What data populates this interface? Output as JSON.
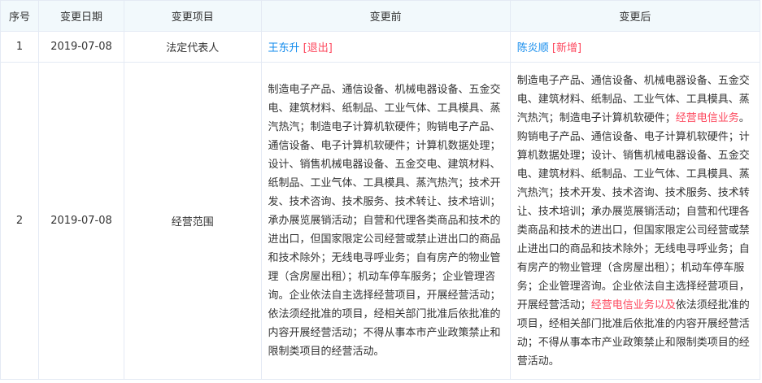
{
  "table": {
    "headers": [
      "序号",
      "变更日期",
      "变更项目",
      "变更前",
      "变更后"
    ],
    "rows": [
      {
        "seq": "1",
        "date": "2019-07-08",
        "item": "法定代表人",
        "before": {
          "name": "王东升",
          "tag": "[退出]"
        },
        "after": {
          "name": "陈炎顺",
          "tag": "[新增]"
        }
      },
      {
        "seq": "2",
        "date": "2019-07-08",
        "item": "经营范围",
        "before_text": "制造电子产品、通信设备、机械电器设备、五金交电、建筑材料、纸制品、工业气体、工具模具、蒸汽热汽；制造电子计算机软硬件；购销电子产品、通信设备、电子计算机软硬件；计算机数据处理；设计、销售机械电器设备、五金交电、建筑材料、纸制品、工业气体、工具模具、蒸汽热汽；技术开发、技术咨询、技术服务、技术转让、技术培训；承办展览展销活动；自营和代理各类商品和技术的进出口，但国家限定公司经营或禁止进出口的商品和技术除外；无线电寻呼业务；自有房产的物业管理（含房屋出租）；机动车停车服务；企业管理咨询。企业依法自主选择经营项目，开展经营活动；依法须经批准的项目，经相关部门批准后依批准的内容开展经营活动；不得从事本市产业政策禁止和限制类项目的经营活动。",
        "after_parts": [
          {
            "text": "制造电子产品、通信设备、机械电器设备、五金交电、建筑材料、纸制品、工业气体、工具模具、蒸汽热汽；制造电子计算机软硬件；",
            "highlight": false
          },
          {
            "text": "经营电信业务",
            "highlight": true
          },
          {
            "text": "。购销电子产品、通信设备、电子计算机软硬件；计算机数据处理；设计、销售机械电器设备、五金交电、建筑材料、纸制品、工业气体、工具模具、蒸汽热汽；技术开发、技术咨询、技术服务、技术转让、技术培训；承办展览展销活动；自营和代理各类商品和技术的进出口，但国家限定公司经营或禁止进出口的商品和技术除外；无线电寻呼业务；自有房产的物业管理（含房屋出租）；机动车停车服务；企业管理咨询。企业依法自主选择经营项目，开展经营活动；",
            "highlight": false
          },
          {
            "text": "经营电信业务以及",
            "highlight": true
          },
          {
            "text": "依法须经批准的项目，经相关部门批准后依批准的内容开展经营活动；不得从事本市产业政策禁止和限制类项目的经营活动。",
            "highlight": false
          }
        ]
      }
    ]
  },
  "colors": {
    "header_bg": "#f2f9fc",
    "border": "#e4eaf4",
    "link_blue": "#128bed",
    "tag_red": "#fd485e",
    "text": "#333333"
  }
}
